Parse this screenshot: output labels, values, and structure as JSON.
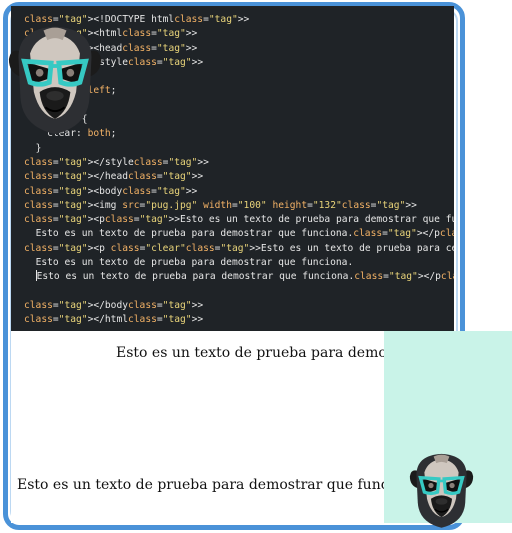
{
  "editor": {
    "lines": [
      "<!DOCTYPE html>",
      "<html>",
      "<head>",
      "<style>",
      "  img {",
      "    float: left;",
      "  }",
      "  p.clear {",
      "    clear: both;",
      "  }",
      "</style>",
      "</head>",
      "<body>",
      "<img src=\"pug.jpg\" width=\"100\" height=\"132\">",
      "<p>Esto es un texto de prueba para demostrar que funciona.",
      "  Esto es un texto de prueba para demostrar que funciona.</p>",
      "<p class=\"clear\">Esto es un texto de prueba para cemostrar que funciona.",
      "  Esto es un texto de prueba para demostrar que funciona.",
      "  Esto es un texto de prueba para demostrar que funciona.</p>",
      "",
      "</body>",
      "</html>"
    ]
  },
  "preview": {
    "paragraph1": "Esto es un texto de prueba para demostrar",
    "paragraph2": "Esto es un texto de prueba para demostrar que funciona. I"
  },
  "colors": {
    "frame": "#4a92d8",
    "editor_bg": "#1f2327",
    "tag": "#ef6b73",
    "attr": "#f3b266",
    "string": "#e9d47a",
    "panel": "#c9f3e8"
  },
  "icons": {
    "image": "pug-with-glasses-icon"
  }
}
